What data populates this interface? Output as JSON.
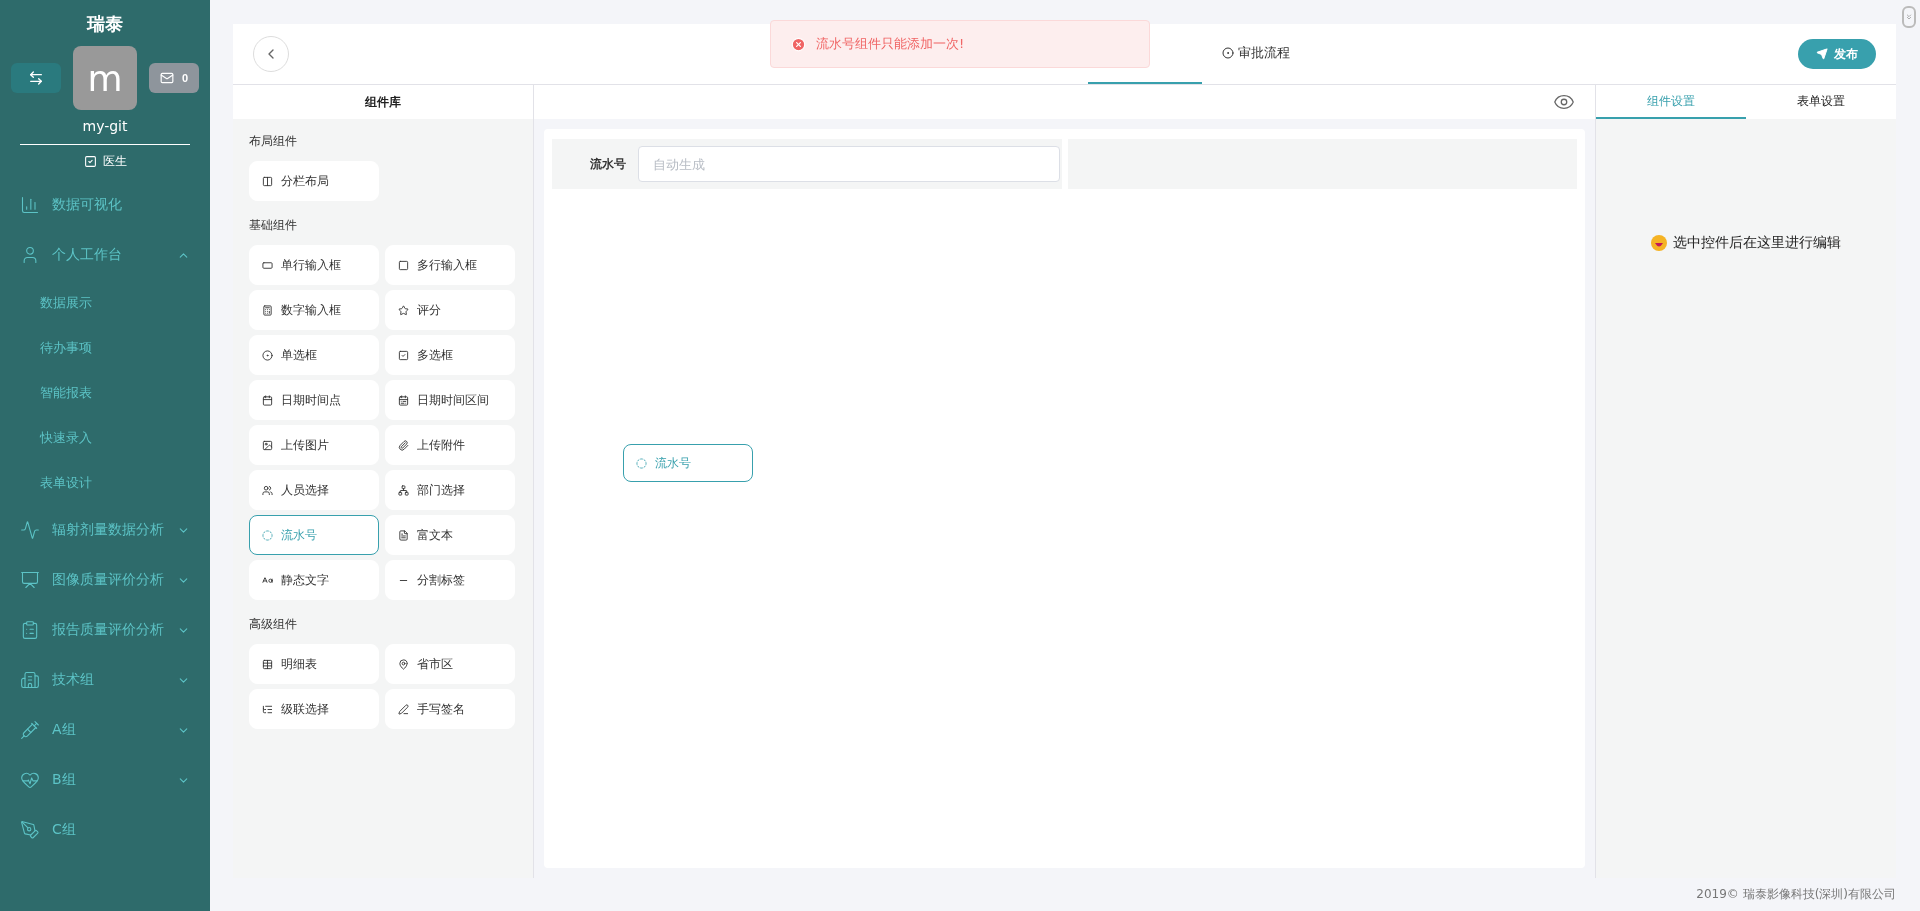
{
  "sidebar": {
    "brand": "瑞泰",
    "avatar_letter": "m",
    "message_count": "0",
    "username": "my-git",
    "role": "医生",
    "menu": [
      {
        "label": "数据可视化"
      },
      {
        "label": "个人工作台",
        "expanded": true,
        "children": [
          {
            "label": "数据展示"
          },
          {
            "label": "待办事项"
          },
          {
            "label": "智能报表"
          },
          {
            "label": "快速录入"
          },
          {
            "label": "表单设计"
          }
        ]
      },
      {
        "label": "辐射剂量数据分析",
        "expanded": false
      },
      {
        "label": "图像质量评价分析",
        "expanded": false
      },
      {
        "label": "报告质量评价分析",
        "expanded": false
      },
      {
        "label": "技术组",
        "expanded": false
      },
      {
        "label": "A组",
        "expanded": false
      },
      {
        "label": "B组",
        "expanded": false
      },
      {
        "label": "C组"
      }
    ]
  },
  "header": {
    "steps": [
      {
        "selected": true
      },
      {
        "label": "审批流程",
        "selected": false
      }
    ],
    "publish_button": "发布"
  },
  "toast": {
    "message": "流水号组件只能添加一次!"
  },
  "library": {
    "title": "组件库",
    "sections": [
      {
        "title": "布局组件",
        "items": [
          {
            "label": "分栏布局",
            "selected": false
          }
        ]
      },
      {
        "title": "基础组件",
        "items": [
          {
            "label": "单行输入框",
            "selected": false
          },
          {
            "label": "多行输入框",
            "selected": false
          },
          {
            "label": "数字输入框",
            "selected": false
          },
          {
            "label": "评分",
            "selected": false
          },
          {
            "label": "单选框",
            "selected": false
          },
          {
            "label": "多选框",
            "selected": false
          },
          {
            "label": "日期时间点",
            "selected": false
          },
          {
            "label": "日期时间区间",
            "selected": false
          },
          {
            "label": "上传图片",
            "selected": false
          },
          {
            "label": "上传附件",
            "selected": false
          },
          {
            "label": "人员选择",
            "selected": false
          },
          {
            "label": "部门选择",
            "selected": false
          },
          {
            "label": "流水号",
            "selected": true
          },
          {
            "label": "富文本",
            "selected": false
          },
          {
            "label": "静态文字",
            "selected": false
          },
          {
            "label": "分割标签",
            "selected": false
          }
        ]
      },
      {
        "title": "高级组件",
        "items": [
          {
            "label": "明细表",
            "selected": false
          },
          {
            "label": "省市区",
            "selected": false
          },
          {
            "label": "级联选择",
            "selected": false
          },
          {
            "label": "手写签名",
            "selected": false
          }
        ]
      }
    ]
  },
  "canvas": {
    "fields": [
      {
        "label": "流水号",
        "placeholder": "自动生成"
      }
    ],
    "dragging_item": "流水号"
  },
  "settings": {
    "tabs": [
      {
        "label": "组件设置",
        "selected": true
      },
      {
        "label": "表单设置",
        "selected": false
      }
    ],
    "hint": "选中控件后在这里进行编辑"
  },
  "footer": "2019© 瑞泰影像科技(深圳)有限公司"
}
